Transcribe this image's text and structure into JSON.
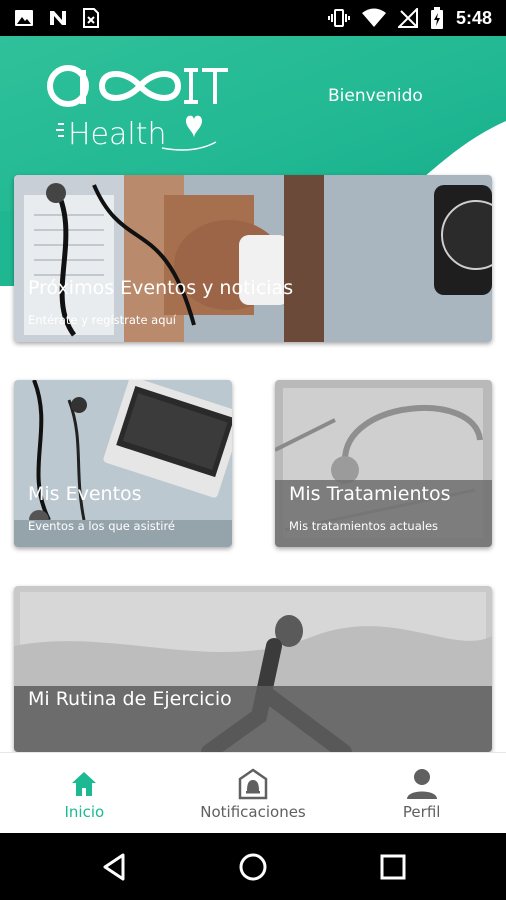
{
  "status_bar": {
    "time": "5:48",
    "left_icons": [
      "image-icon",
      "n-icon",
      "file-x-icon"
    ],
    "right_icons": [
      "vibrate-icon",
      "wifi-icon",
      "no-signal-icon",
      "battery-charging-icon"
    ]
  },
  "header": {
    "logo_text_top": "ACCIT",
    "logo_text_bottom": "Health",
    "welcome": "Bienvenido",
    "accent_color": "#1fb792"
  },
  "cards": {
    "proximos": {
      "title": "Próximos Eventos y noticias",
      "subtitle": "Entérate y regístrate aquí"
    },
    "eventos": {
      "title": "Mis Eventos",
      "subtitle": "Eventos a los que asistiré"
    },
    "tratamientos": {
      "title": "Mis Tratamientos",
      "subtitle": "Mis tratamientos actuales"
    },
    "rutina": {
      "title": "Mi Rutina de Ejercicio"
    }
  },
  "bottom_nav": {
    "items": [
      {
        "label": "Inicio",
        "icon": "home-icon",
        "active": true
      },
      {
        "label": "Notificaciones",
        "icon": "bell-icon",
        "active": false
      },
      {
        "label": "Perfil",
        "icon": "person-icon",
        "active": false
      }
    ],
    "active_color": "#1db992",
    "inactive_color": "#606060"
  },
  "system_nav": [
    "back-icon",
    "home-circle-icon",
    "recents-icon"
  ]
}
